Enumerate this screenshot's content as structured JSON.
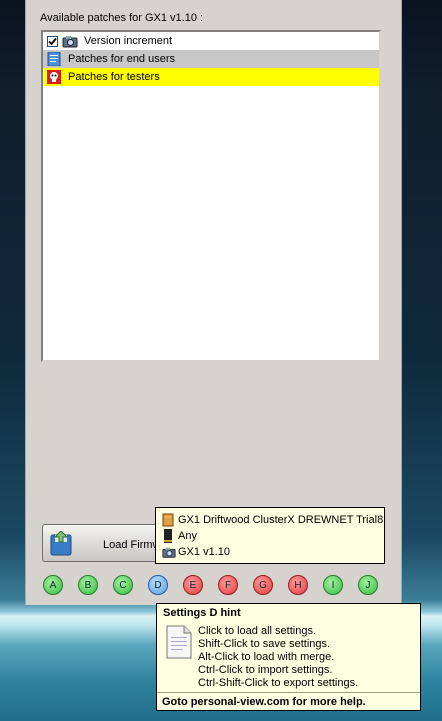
{
  "panel": {
    "title": "Available patches for GX1 v1.10 :"
  },
  "patches": [
    {
      "label": "Version increment",
      "checked": true,
      "icon": "camera-icon"
    },
    {
      "label": "Patches for end users",
      "icon": "document-icon"
    },
    {
      "label": "Patches for testers",
      "icon": "skull-icon"
    }
  ],
  "load_button": {
    "label": "Load Firmw"
  },
  "settings_letters": [
    "A",
    "B",
    "C",
    "D",
    "E",
    "F",
    "G",
    "H",
    "I",
    "J"
  ],
  "info_tooltip": {
    "lines": [
      {
        "text": "GX1 Driftwood ClusterX DREWNET Trial8",
        "icon": "battery-icon"
      },
      {
        "text": "Any",
        "icon": "lens-icon"
      },
      {
        "text": "GX1 v1.10",
        "icon": "camera-icon"
      }
    ]
  },
  "settings_hint": {
    "title": "Settings D hint",
    "lines": [
      "Click to load all settings.",
      "Shift-Click to save settings.",
      "Alt-Click to load with merge.",
      "Ctrl-Click to import settings.",
      "Ctrl-Shift-Click to export settings."
    ],
    "footer": "Goto personal-view.com for more help."
  }
}
